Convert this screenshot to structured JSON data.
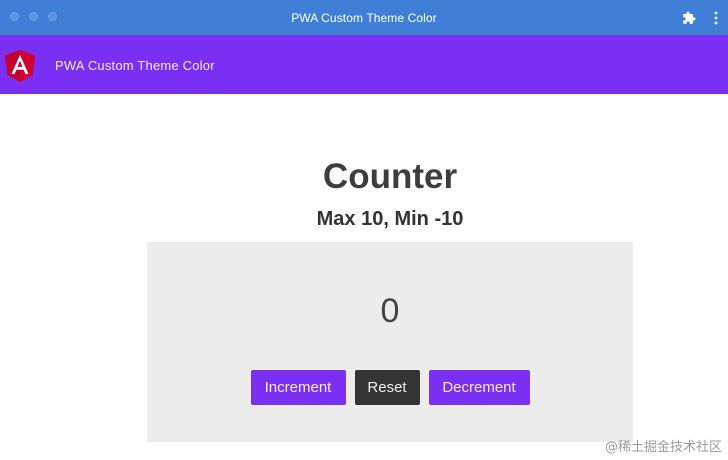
{
  "window": {
    "title": "PWA Custom Theme Color",
    "titlebar_color": "#3f7fd6",
    "icons": [
      "extension-icon",
      "more-vert-icon"
    ]
  },
  "toolbar": {
    "logo": "angular-logo",
    "title": "PWA Custom Theme Color",
    "color": "#7b2ff2"
  },
  "counter": {
    "heading": "Counter",
    "subheading": "Max 10, Min -10",
    "value": "0",
    "buttons": {
      "increment": "Increment",
      "reset": "Reset",
      "decrement": "Decrement"
    },
    "primary_color": "#7b2ff2",
    "reset_color": "#343434"
  },
  "watermark": "@稀土掘金技术社区"
}
